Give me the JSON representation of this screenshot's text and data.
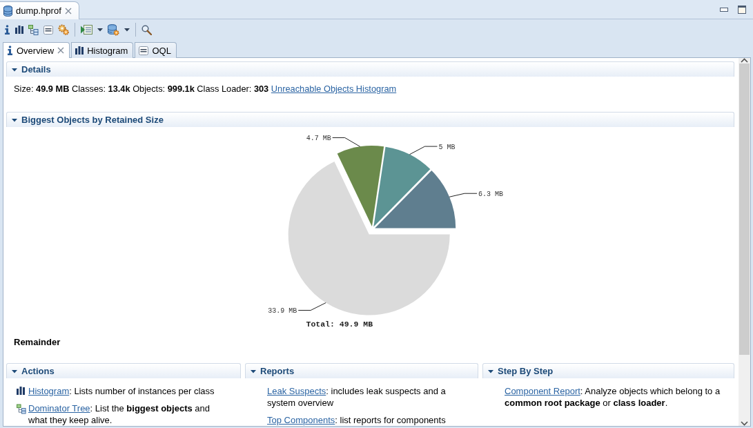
{
  "editor_tabs": [
    {
      "label": "dump.hprof",
      "selected": true,
      "closable": true
    }
  ],
  "view_tabs": [
    {
      "label": "Overview",
      "selected": true,
      "closable": true
    },
    {
      "label": "Histogram",
      "selected": false,
      "closable": false
    },
    {
      "label": "OQL",
      "selected": false,
      "closable": false
    }
  ],
  "details": {
    "title": "Details",
    "expanded": true,
    "summary": "Size: **49.9 MB** Classes: **13.4k** Objects: **999.1k** Class Loader: **303**",
    "link": "Unreachable Objects Histogram"
  },
  "biggest_objects": {
    "title": "Biggest Objects by Retained Size",
    "expanded": true,
    "chart_data": {
      "type": "pie",
      "values": [
        6.3,
        5,
        4.7,
        33.9
      ],
      "value_labels": [
        "6.3 MB",
        "5 MB",
        "4.7 MB",
        "33.9 MB"
      ],
      "annotations": [
        {
          "text": "Total: 49.9 MB"
        }
      ]
    },
    "hovered_object": "Remainder"
  },
  "panels": [
    {
      "title": "Actions",
      "expanded": true,
      "items": [
        {
          "kind": "histogram",
          "link": "Histogram",
          "text": ": Lists number of instances per class"
        },
        {
          "kind": "tree",
          "link": "Dominator Tree",
          "text": ": List the **biggest objects** and what they keep alive."
        }
      ]
    },
    {
      "title": "Reports",
      "expanded": true,
      "items": [
        {
          "kind": "plain",
          "link": "Leak Suspects",
          "text": ": includes leak suspects and a system overview"
        },
        {
          "kind": "plain",
          "link": "Top Components",
          "text": ": list reports for components"
        }
      ]
    },
    {
      "title": "Step By Step",
      "expanded": true,
      "items": [
        {
          "kind": "plain",
          "link": "Component Report",
          "text": ": Analyze objects which belong to a **common root package** or **class loader**."
        }
      ]
    }
  ]
}
